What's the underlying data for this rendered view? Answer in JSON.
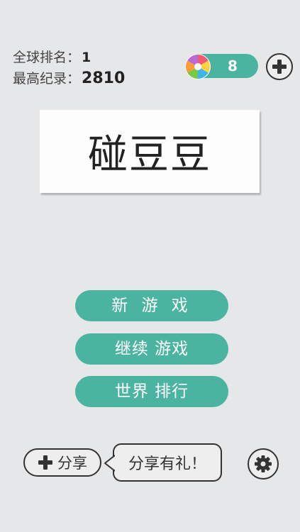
{
  "stats": {
    "rank_label": "全球排名：",
    "rank_value": "1",
    "record_label": "最高纪录：",
    "record_value": "2810"
  },
  "coins": {
    "icon": "pinwheel-candy-icon",
    "count": "8",
    "add_icon": "plus-icon"
  },
  "title": "碰豆豆",
  "menu": {
    "new_game": "新 游 戏",
    "continue_game": "继续 游戏",
    "world_rank": "世界 排行"
  },
  "share": {
    "button_label": "分享",
    "bubble_text": "分享有礼！"
  },
  "settings_icon": "gear-icon",
  "colors": {
    "background": "#e6e7e9",
    "accent": "#4ab4a0",
    "card": "#fdfdfd"
  }
}
